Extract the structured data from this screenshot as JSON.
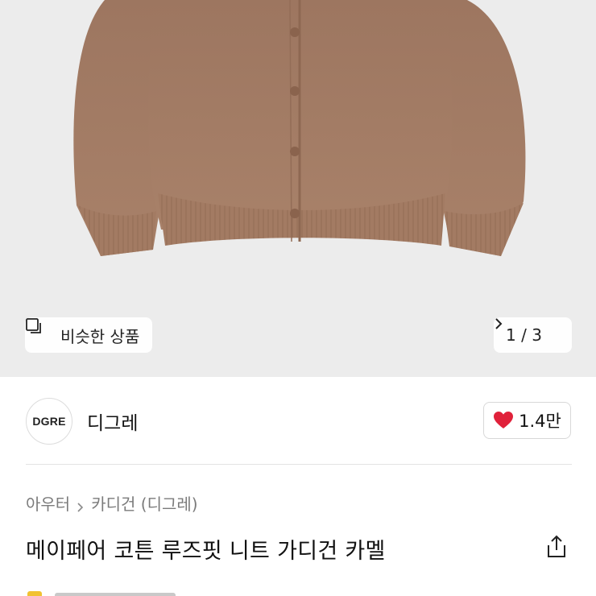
{
  "hero": {
    "similar_label": "비슷한 상품",
    "pager": "1 / 3"
  },
  "brand": {
    "logo_text": "DGRE",
    "name": "디그레",
    "likes": "1.4만"
  },
  "breadcrumb": {
    "items": [
      "아우터",
      "카디건 (디그레)"
    ]
  },
  "product": {
    "title": "메이페어 코튼 루즈핏 니트 가디건 카멜"
  },
  "colors": {
    "hero_bg": "#ececec",
    "garment": "#a67e66",
    "like_heart": "#e0213a"
  },
  "icons": [
    "similar-products-icon",
    "chevron-right-icon",
    "heart-icon",
    "share-icon"
  ]
}
